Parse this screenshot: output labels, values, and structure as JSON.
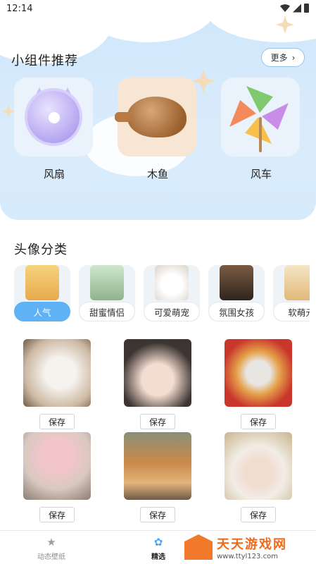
{
  "status_bar": {
    "time": "12:14"
  },
  "widgets": {
    "title": "小组件推荐",
    "more_label": "更多",
    "items": [
      {
        "label": "风扇",
        "icon": "fan-icon"
      },
      {
        "label": "木鱼",
        "icon": "wooden-fish-icon"
      },
      {
        "label": "风车",
        "icon": "pinwheel-icon"
      }
    ]
  },
  "avatar_categories": {
    "title": "头像分类",
    "items": [
      {
        "label": "人气",
        "active": true
      },
      {
        "label": "甜蜜情侣",
        "active": false
      },
      {
        "label": "可爱萌宠",
        "active": false
      },
      {
        "label": "氛围女孩",
        "active": false
      },
      {
        "label": "软萌元",
        "active": false
      }
    ]
  },
  "avatars": {
    "save_label": "保存",
    "items": [
      {
        "subject": "white-dog-photo"
      },
      {
        "subject": "girl-with-headband-photo"
      },
      {
        "subject": "cat-in-burger-photo"
      },
      {
        "subject": "child-pink-hat-photo"
      },
      {
        "subject": "three-shiba-dogs-photo"
      },
      {
        "subject": "girl-white-hat-photo"
      }
    ]
  },
  "tabbar": {
    "items": [
      {
        "label": "动态壁纸",
        "icon": "star-icon",
        "active": false
      },
      {
        "label": "精选",
        "icon": "flower-icon",
        "active": true
      }
    ]
  },
  "watermark": {
    "title": "天天游戏网",
    "url": "www.ttyl123.com"
  },
  "colors": {
    "accent": "#5fb2f6",
    "hero_bg": "#d6ebfb",
    "watermark": "#f06a1a"
  }
}
